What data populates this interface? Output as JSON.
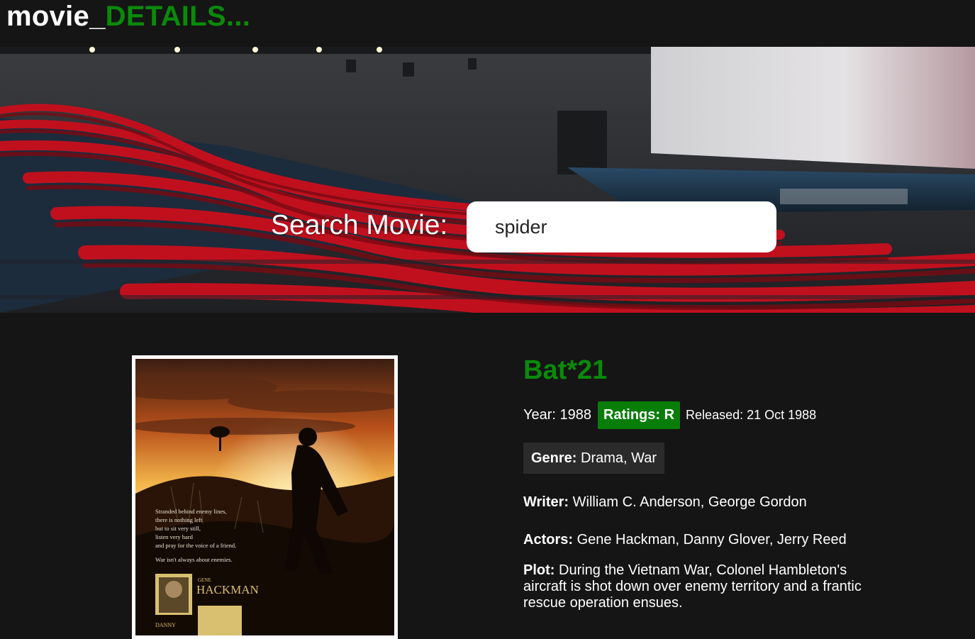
{
  "header": {
    "logo_prefix": "movie_",
    "logo_accent": "DETAILS..."
  },
  "search": {
    "label": "Search Movie:",
    "value": "spider"
  },
  "movie": {
    "title": "Bat*21",
    "year_label": "Year:",
    "year": "1988",
    "ratings_label": "Ratings:",
    "rating": "R",
    "released_label": "Released:",
    "released": "21 Oct 1988",
    "genre_label": "Genre:",
    "genre": "Drama, War",
    "writer_label": "Writer:",
    "writer": "William C. Anderson, George Gordon",
    "actors_label": "Actors:",
    "actors": "Gene Hackman, Danny Glover, Jerry Reed",
    "plot_label": "Plot:",
    "plot": "During the Vietnam War, Colonel Hambleton's aircraft is shot down over enemy territory and a frantic rescue operation ensues."
  },
  "poster": {
    "tagline_lines": [
      "Stranded behind enemy lines,",
      "there is nothing left",
      "but to sit very still,",
      "listen very hard",
      "and pray for the voice of a friend.",
      "",
      "War isn't always about enemies."
    ],
    "actor1_first": "GENE",
    "actor1_last": "HACKMAN",
    "actor2_first": "DANNY"
  },
  "colors": {
    "accent_green": "#0a8a0a",
    "badge_green": "#087e08",
    "background": "#151515",
    "genre_bg": "#2b2b2b",
    "seat_red": "#c0101e"
  }
}
